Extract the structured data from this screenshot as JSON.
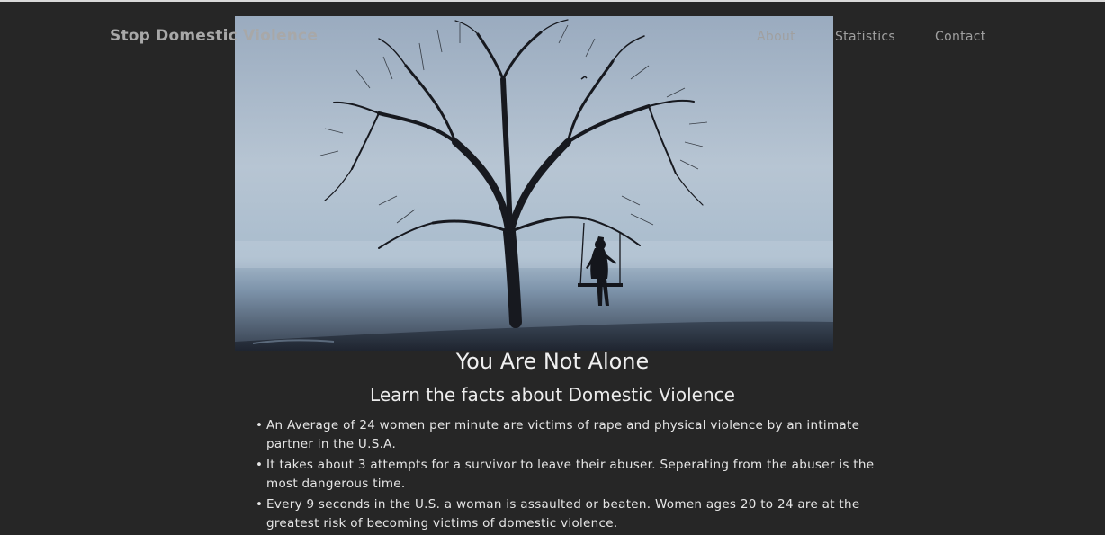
{
  "brand": "Stop Domestic Violence",
  "nav": {
    "about": "About",
    "statistics": "Statistics",
    "contact": "Contact"
  },
  "hero": {
    "title": "You Are Not Alone",
    "subtitle": "Learn the facts about Domestic Violence"
  },
  "facts": [
    "An Average of 24 women per minute are victims of rape and physical violence by an intimate partner in the U.S.A.",
    "It takes about 3 attempts for a survivor to leave their abuser. Seperating from the abuser is the most dangerous time.",
    "Every 9 seconds in the U.S. a woman is assaulted or beaten. Women ages 20 to 24 are at the greatest risk of becoming victims of domestic violence."
  ],
  "colors": {
    "background": "#262626",
    "sky_top": "#9fb0c4",
    "sky_bottom": "#c4d0dc",
    "silhouette": "#14161c"
  },
  "icons": {
    "bullet": "bullet-dot-icon"
  }
}
